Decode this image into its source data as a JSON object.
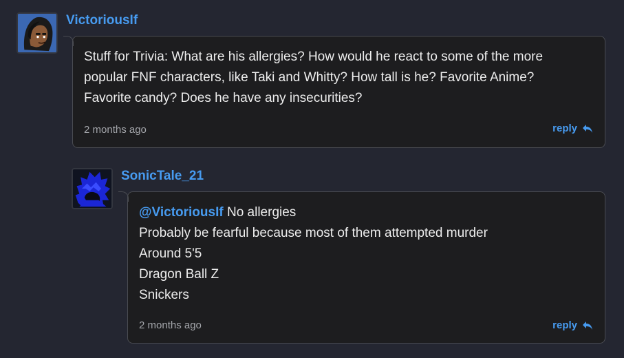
{
  "comments": [
    {
      "username": "VictoriousIf",
      "avatar_icon": "hooded-character-avatar-icon",
      "body_lines": [
        "Stuff for Trivia: What are his allergies? How would he react to some of the more",
        "popular FNF characters, like Taki and Whitty? How tall is he? Favorite Anime?",
        "Favorite candy? Does he have any insecurities?"
      ],
      "timestamp": "2 months ago",
      "reply_label": "reply"
    },
    {
      "username": "SonicTale_21",
      "avatar_icon": "blue-haired-character-avatar-icon",
      "mention": "@VictoriousIf",
      "body_lines": [
        "No allergies",
        "Probably be fearful because most of them attempted murder",
        "Around 5'5",
        "Dragon Ball Z",
        "Snickers"
      ],
      "timestamp": "2 months ago",
      "reply_label": "reply"
    }
  ],
  "colors": {
    "background": "#242631",
    "bubble": "#1d1d1f",
    "accent": "#479bf0",
    "text": "#ededed",
    "muted": "#a4a6ab"
  }
}
